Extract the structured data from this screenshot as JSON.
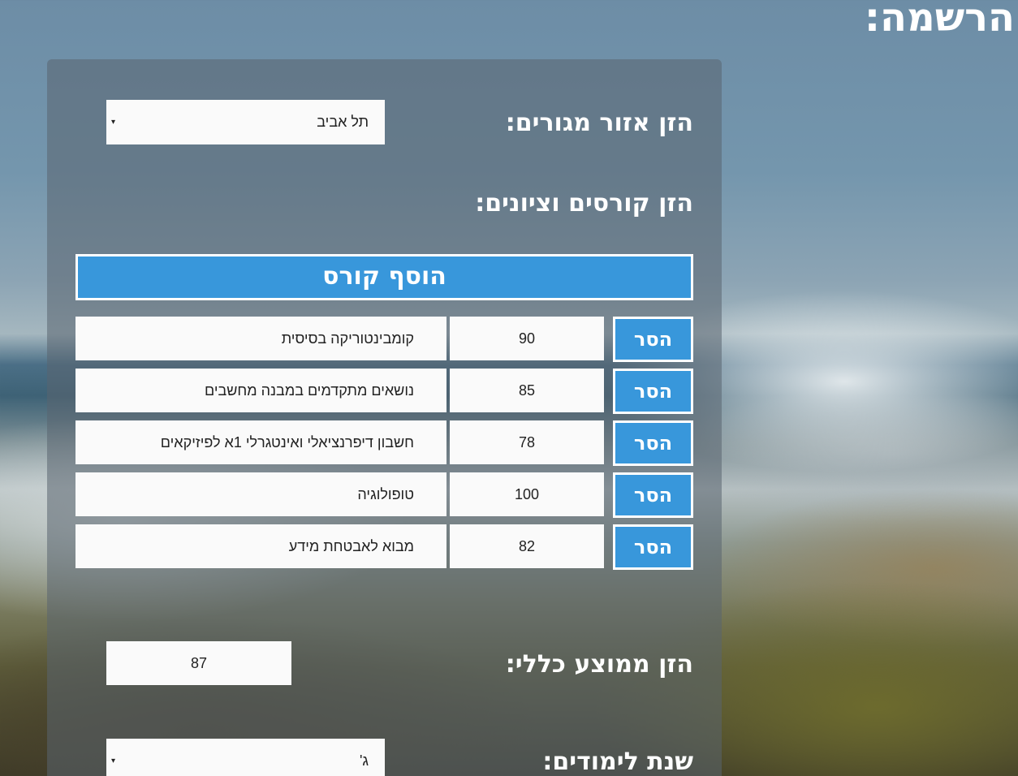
{
  "page_title": "הרשמה:",
  "residence": {
    "label": "הזן אזור מגורים:",
    "selected": "תל אביב",
    "arrow_icon": "▾"
  },
  "courses": {
    "label": "הזן קורסים וציונים:",
    "add_button": "הוסף קורס",
    "remove_label": "הסר",
    "rows": [
      {
        "name": "קומבינטוריקה בסיסית",
        "grade": "90"
      },
      {
        "name": "נושאים מתקדמים במבנה מחשבים",
        "grade": "85"
      },
      {
        "name": "חשבון דיפרנציאלי ואינטגרלי 1א לפיזיקאים",
        "grade": "78"
      },
      {
        "name": "טופולוגיה",
        "grade": "100"
      },
      {
        "name": "מבוא לאבטחת מידע",
        "grade": "82"
      }
    ]
  },
  "average": {
    "label": "הזן ממוצע כללי:",
    "value": "87"
  },
  "study_year": {
    "label": "שנת לימודים:",
    "selected": "ג'",
    "arrow_icon": "▾"
  },
  "colors": {
    "accent": "#3897db",
    "panel": "rgba(90,100,112,0.55)"
  }
}
